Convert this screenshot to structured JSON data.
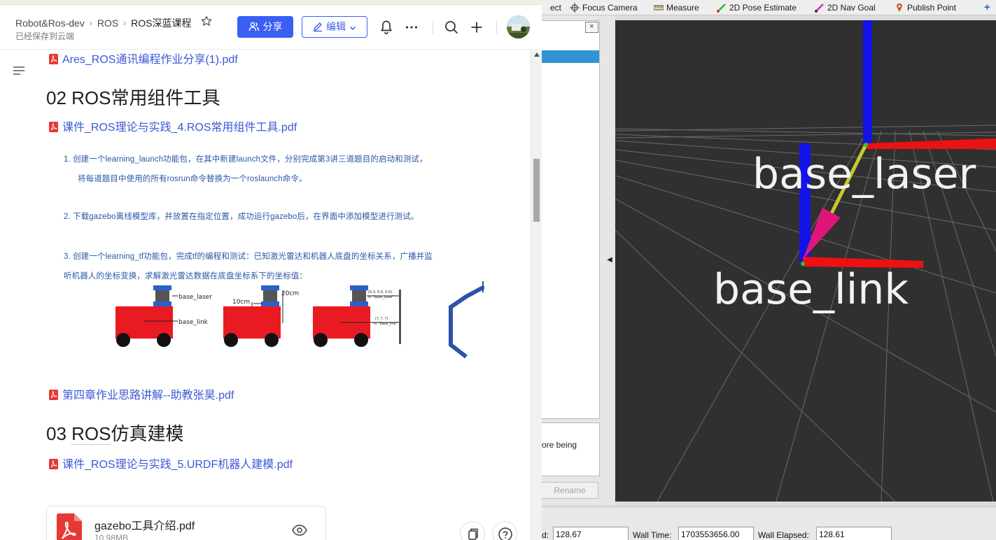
{
  "rviz": {
    "toolbar": {
      "select_partial": "ect",
      "focus_camera": "Focus Camera",
      "measure": "Measure",
      "pose_estimate": "2D Pose Estimate",
      "nav_goal": "2D Nav Goal",
      "publish_point": "Publish Point"
    },
    "panel_close": "×",
    "description_partial": "ore being",
    "rename_button": "Rename",
    "collapse_arrow": "◀",
    "frames": {
      "laser_label": "base_laser",
      "link_label": "base_link"
    },
    "status": {
      "ros_elapsed_label_partial": "d:",
      "ros_elapsed_value": "128.67",
      "wall_time_label": "Wall Time:",
      "wall_time_value": "1703553656.00",
      "wall_elapsed_label": "Wall Elapsed:",
      "wall_elapsed_value": "128.61"
    }
  },
  "doc": {
    "breadcrumb": {
      "space": "Robot&Ros-dev",
      "folder": "ROS",
      "page": "ROS深蓝课程",
      "sep": "›"
    },
    "save_status": "已经保存到云端",
    "share_label": "分享",
    "edit_label": "编辑",
    "top_link": "Ares_ROS通讯编程作业分享(1).pdf",
    "section2_title": "02 ROS常用组件工具",
    "section2_link": "课件_ROS理论与实践_4.ROS常用组件工具.pdf",
    "tasks": {
      "t1_line1": "1.   创建一个learning_launch功能包，在其中新建launch文件，分别完成第3讲三道题目的启动和测试，",
      "t1_line2": "将每道题目中使用的所有rosrun命令替换为一个roslaunch命令。",
      "t2": "2.   下载gazebo离线模型库，并放置在指定位置，成功运行gazebo后，在界面中添加模型进行测试。",
      "t3_line1": "3. 创建一个learning_tf功能包，完成tf的编程和测试：已知激光雷达和机器人底盘的坐标关系，广播并监",
      "t3_line2": "听机器人的坐标变换，求解激光雷达数据在底盘坐标系下的坐标值：",
      "fig_base_laser": "base_laser",
      "fig_base_link": "base_link",
      "fig_10cm": "10cm",
      "fig_20cm": "20cm",
      "fig_coord1": "(0.3, 0.0, 0.0)",
      "fig_coord1_sub": "in \"base_laser\"",
      "fig_coord2": "(?, ?, ?)",
      "fig_coord2_sub": "in \"base_link\""
    },
    "chapter4_link": "第四章作业思路讲解--助教张昊.pdf",
    "section3_prefix": "03 ",
    "section3_ros": "ROS",
    "section3_suffix": "仿真建模",
    "section3_link": "课件_ROS理论与实践_5.URDF机器人建模.pdf",
    "file_card": {
      "name": "gazebo工具介绍.pdf",
      "size": "10.98MB"
    }
  },
  "colors": {
    "accent": "#3a5ff2",
    "link": "#3b58d6",
    "pdf_red": "#e53935",
    "rviz_bg": "#303030"
  }
}
